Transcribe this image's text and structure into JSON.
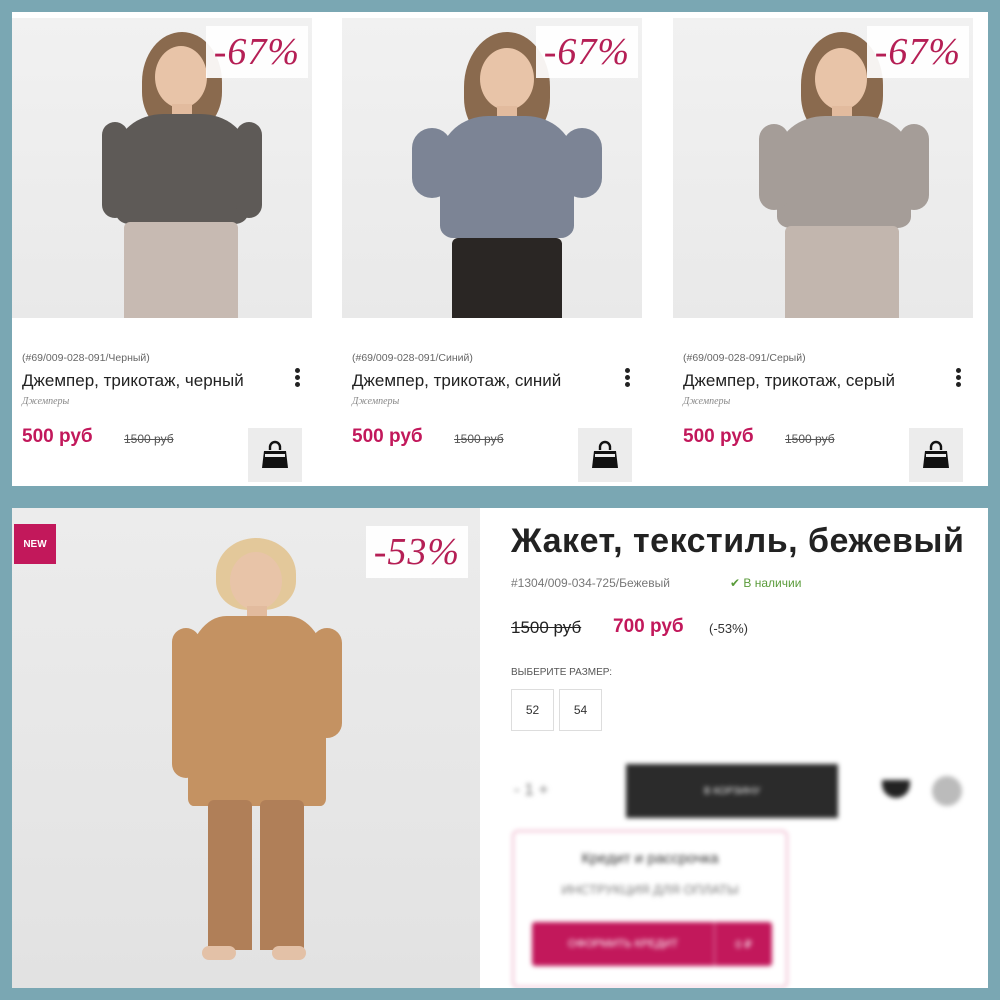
{
  "cards": [
    {
      "discount": "-67%",
      "sku": "(#69/009-028-091/Черный)",
      "name": "Джемпер, трикотаж, черный",
      "category": "Джемперы",
      "price": "500 руб",
      "old_price": "1500 руб",
      "colors": {
        "top": "#5e5a57",
        "bottom": "#c7bab2",
        "hair": "#8a6a4e"
      }
    },
    {
      "discount": "-67%",
      "sku": "(#69/009-028-091/Синий)",
      "name": "Джемпер, трикотаж, синий",
      "category": "Джемперы",
      "price": "500 руб",
      "old_price": "1500 руб",
      "colors": {
        "top": "#7c8495",
        "bottom": "#2a2624",
        "hair": "#8a6a4e"
      }
    },
    {
      "discount": "-67%",
      "sku": "(#69/009-028-091/Серый)",
      "name": "Джемпер, трикотаж, серый",
      "category": "Джемперы",
      "price": "500 руб",
      "old_price": "1500 руб",
      "colors": {
        "top": "#a59d98",
        "bottom": "#c2b6ae",
        "hair": "#8a6a4e"
      }
    }
  ],
  "detail": {
    "badge": "NEW",
    "discount": "-53%",
    "title": "Жакет, текстиль, бежевый",
    "sku": "#1304/009-034-725/Бежевый",
    "stock": "✔ В наличии",
    "old_price": "1500 руб",
    "price": "700 руб",
    "pct": "(-53%)",
    "size_label": "ВЫБЕРИТЕ РАЗМЕР:",
    "sizes": [
      "52",
      "54"
    ],
    "qty": "-   1   +",
    "add_to_cart": "В КОРЗИНУ",
    "credit_title": "Кредит и рассрочка",
    "credit_sub": "ИНСТРУКЦИЯ ДЛЯ ОПЛАТЫ",
    "credit_button": "ОФОРМИТЬ КРЕДИТ",
    "credit_button_side": "0 ₽",
    "colors": {
      "jacket": "#c49262",
      "pants": "#b07f58",
      "hair": "#e3c89a"
    }
  },
  "theme": {
    "accent": "#c2185b",
    "frame": "#7aa7b3"
  }
}
